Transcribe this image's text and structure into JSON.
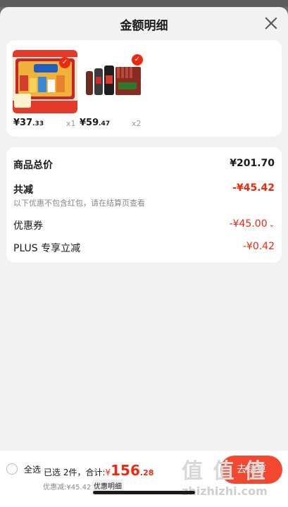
{
  "sheet": {
    "title": "金额明细"
  },
  "products": [
    {
      "price_int": "¥37",
      "price_dec": ".33",
      "qty": "x1"
    },
    {
      "price_int": "¥59",
      "price_dec": ".47",
      "qty": "x2"
    }
  ],
  "summary": {
    "total_label": "商品总价",
    "total_value": "¥201.70",
    "reduce_label": "共减",
    "reduce_value": "-¥45.42",
    "reduce_note": "以下优惠不包含红包，请在结算页查看",
    "coupon_label": "优惠券",
    "coupon_value": "-¥45.00",
    "plus_label": "PLUS 专享立减",
    "plus_value": "-¥0.42"
  },
  "bottom_bar": {
    "select_all": "全选",
    "selected_text": "已选 2件，合计:",
    "total_symbol": "¥",
    "total_int": "156",
    "total_dec": ".28",
    "discount_text": "优惠减:¥45.42",
    "detail_label": "优惠明细",
    "checkout_label": "去结算"
  },
  "watermark": {
    "site": "zhizhizhi.com"
  },
  "colors": {
    "accent": "#f2270c",
    "background": "#f2f2f2",
    "card": "#ffffff"
  }
}
